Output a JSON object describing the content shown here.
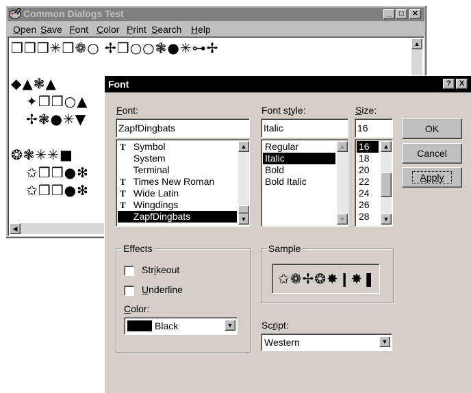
{
  "main_window": {
    "title": "Common Dialogs Test",
    "menu": [
      {
        "label": "Open",
        "access": "O"
      },
      {
        "label": "Save",
        "access": "S"
      },
      {
        "label": "Font",
        "access": "F"
      },
      {
        "label": "Color",
        "access": "C"
      },
      {
        "label": "Print",
        "access": "P"
      },
      {
        "label": "Search",
        "access": "S"
      },
      {
        "label": "Help",
        "access": "H"
      }
    ],
    "text_lines": [
      "❒❒❒✳❒❁○ ✢❒○○❃●✳⊶✢",
      "◆▲❃▲",
      "✦❒❒○▲",
      "✢❃●✳▼",
      "❂❃✳✳■",
      "✩❒❒●❇",
      "✩❒❒●❇"
    ]
  },
  "font_dialog": {
    "title": "Font",
    "help_button": "?",
    "close_button": "X",
    "font_label": "Font:",
    "font_value": "ZapfDingbats",
    "fonts": [
      {
        "name": "Symbol",
        "tt": true
      },
      {
        "name": "System",
        "tt": false
      },
      {
        "name": "Terminal",
        "tt": false
      },
      {
        "name": "Times New Roman",
        "tt": true
      },
      {
        "name": "Wide Latin",
        "tt": true
      },
      {
        "name": "Wingdings",
        "tt": true
      },
      {
        "name": "ZapfDingbats",
        "tt": false,
        "selected": true
      }
    ],
    "style_label": "Font style:",
    "style_value": "Italic",
    "styles": [
      {
        "name": "Regular"
      },
      {
        "name": "Italic",
        "selected": true
      },
      {
        "name": "Bold"
      },
      {
        "name": "Bold Italic"
      }
    ],
    "size_label": "Size:",
    "size_value": "16",
    "sizes": [
      {
        "name": "16",
        "selected": true
      },
      {
        "name": "18"
      },
      {
        "name": "20"
      },
      {
        "name": "22"
      },
      {
        "name": "24"
      },
      {
        "name": "26"
      },
      {
        "name": "28"
      }
    ],
    "ok_label": "OK",
    "cancel_label": "Cancel",
    "apply_label": "Apply",
    "effects_label": "Effects",
    "strikeout_label": "Strikeout",
    "strikeout_checked": false,
    "underline_label": "Underline",
    "underline_checked": false,
    "color_label": "Color:",
    "color_value": "Black",
    "color_swatch": "#000000",
    "sample_label": "Sample",
    "sample_text": "✩❁✢❂✸❙✸❚",
    "script_label": "Script:",
    "script_value": "Western"
  },
  "colors": {
    "active_title": "#000000",
    "inactive_title": "#808080",
    "face": "#c0c0c0",
    "dialog_face": "#d4d0c8",
    "selection": "#000000"
  }
}
